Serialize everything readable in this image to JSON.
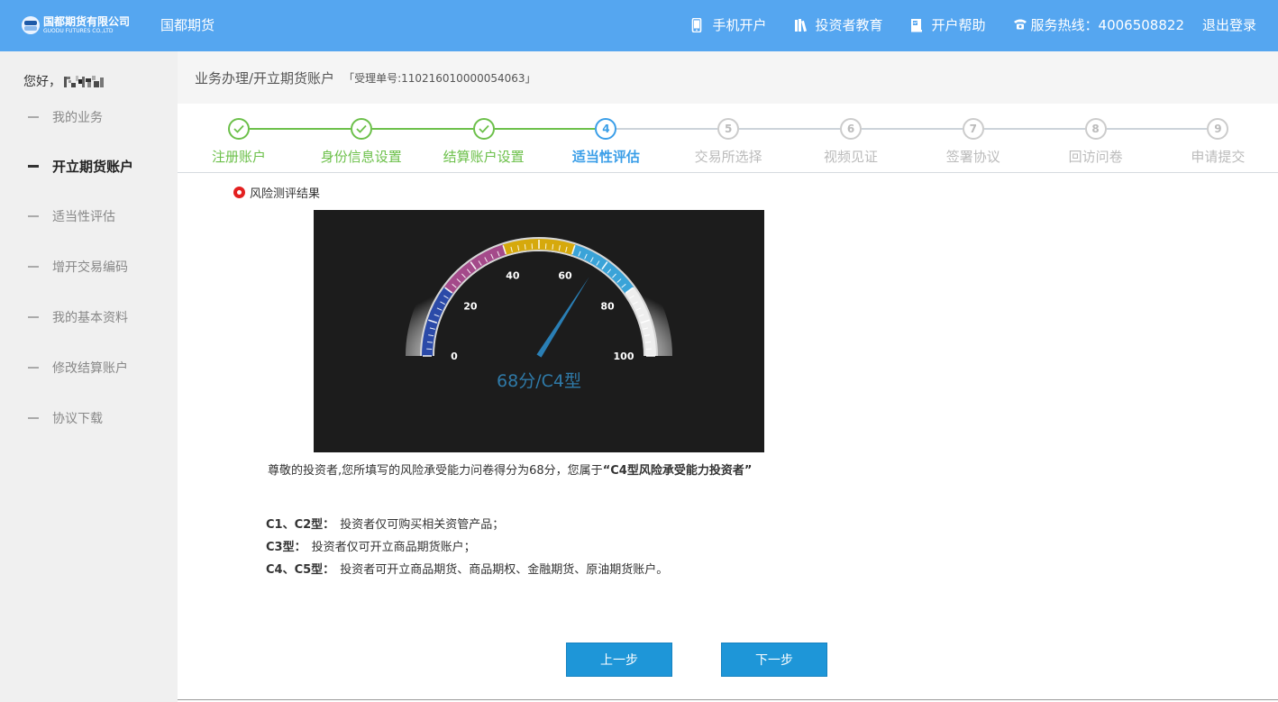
{
  "header": {
    "logo_cn": "国都期货有限公司",
    "logo_en": "GUODU FUTURES CO.,LTD",
    "brand": "国都期货",
    "nav": [
      {
        "label": "手机开户",
        "icon": "phone-icon"
      },
      {
        "label": "投资者教育",
        "icon": "books-icon"
      },
      {
        "label": "开户帮助",
        "icon": "help-book-icon"
      },
      {
        "label": "服务热线：4006508822",
        "icon": "telephone-icon"
      },
      {
        "label": "退出登录"
      }
    ]
  },
  "sidebar": {
    "greeting": "您好，",
    "items": [
      {
        "label": "我的业务",
        "active": false
      },
      {
        "label": "开立期货账户",
        "active": true
      },
      {
        "label": "适当性评估",
        "active": false
      },
      {
        "label": "增开交易编码",
        "active": false
      },
      {
        "label": "我的基本资料",
        "active": false
      },
      {
        "label": "修改结算账户",
        "active": false
      },
      {
        "label": "协议下载",
        "active": false
      }
    ]
  },
  "main": {
    "breadcrumb": "业务办理/开立期货账户",
    "ticket": "「受理单号:110216010000054063」",
    "steps": [
      {
        "num": "1",
        "label": "注册账户",
        "state": "done"
      },
      {
        "num": "2",
        "label": "身份信息设置",
        "state": "done"
      },
      {
        "num": "3",
        "label": "结算账户设置",
        "state": "done"
      },
      {
        "num": "4",
        "label": "适当性评估",
        "state": "current"
      },
      {
        "num": "5",
        "label": "交易所选择",
        "state": "todo"
      },
      {
        "num": "6",
        "label": "视频见证",
        "state": "todo"
      },
      {
        "num": "7",
        "label": "签署协议",
        "state": "todo"
      },
      {
        "num": "8",
        "label": "回访问卷",
        "state": "todo"
      },
      {
        "num": "9",
        "label": "申请提交",
        "state": "todo"
      }
    ],
    "section_title": "风险测评结果",
    "gauge": {
      "value": 68,
      "min": 0,
      "max": 100,
      "tick_labels": [
        "0",
        "20",
        "40",
        "60",
        "80",
        "100"
      ],
      "readout": "68分/C4型"
    },
    "result_prefix": "尊敬的投资者,您所填写的风险承受能力问卷得分为68分，您属于",
    "result_type": "“C4型风险承受能力投资者”",
    "types": [
      {
        "label": "C1、C2型：",
        "desc": "投资者仅可购买相关资管产品；"
      },
      {
        "label": "C3型：",
        "desc": "投资者仅可开立商品期货账户；"
      },
      {
        "label": "C4、C5型：",
        "desc": "投资者可开立商品期货、商品期权、金融期货、原油期货账户。"
      }
    ],
    "prev_label": "上一步",
    "next_label": "下一步"
  }
}
